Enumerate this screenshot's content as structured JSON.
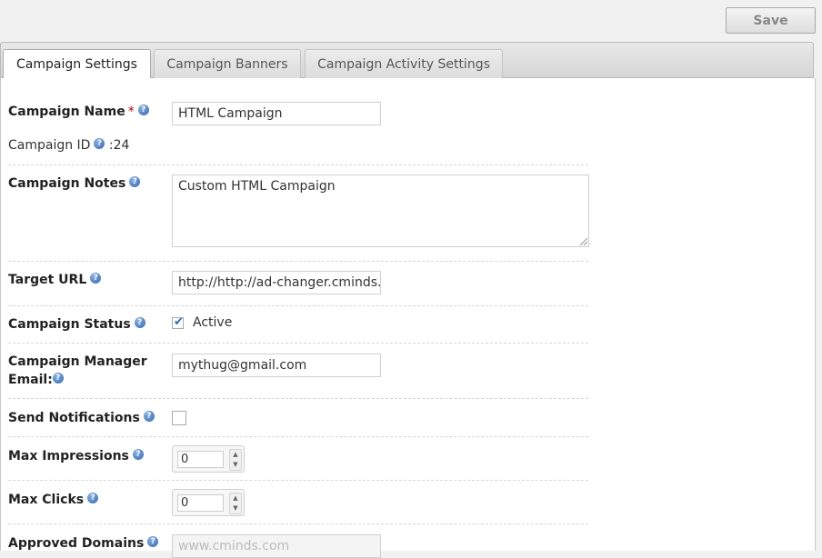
{
  "toolbar": {
    "save_label": "Save"
  },
  "tabs": [
    {
      "label": "Campaign Settings",
      "active": true
    },
    {
      "label": "Campaign Banners",
      "active": false
    },
    {
      "label": "Campaign Activity Settings",
      "active": false
    }
  ],
  "form": {
    "campaign_name": {
      "label": "Campaign Name",
      "required_mark": "*",
      "value": "HTML Campaign"
    },
    "campaign_id": {
      "label": "Campaign ID",
      "value": ":24"
    },
    "campaign_notes": {
      "label": "Campaign Notes",
      "value": "Custom HTML Campaign"
    },
    "target_url": {
      "label": "Target URL",
      "value": "http://http://ad-changer.cminds.com"
    },
    "campaign_status": {
      "label": "Campaign Status",
      "checkbox_label": "Active",
      "checked": true
    },
    "manager_email": {
      "label_line1": "Campaign Manager",
      "label_line2": "Email:",
      "value": "mythug@gmail.com"
    },
    "send_notifications": {
      "label": "Send Notifications",
      "checked": false
    },
    "max_impressions": {
      "label": "Max Impressions",
      "value": "0"
    },
    "max_clicks": {
      "label": "Max Clicks",
      "value": "0"
    },
    "approved_domains": {
      "label": "Approved Domains",
      "placeholder": "www.cminds.com"
    }
  },
  "icons": {
    "help": "help-icon",
    "checkmark": "checkmark-icon",
    "spinner_up": "arrow-up-icon",
    "spinner_down": "arrow-down-icon"
  },
  "colors": {
    "required": "#cc0000",
    "help_icon": "#2f66b8",
    "checkmark": "#1d6fb8"
  }
}
